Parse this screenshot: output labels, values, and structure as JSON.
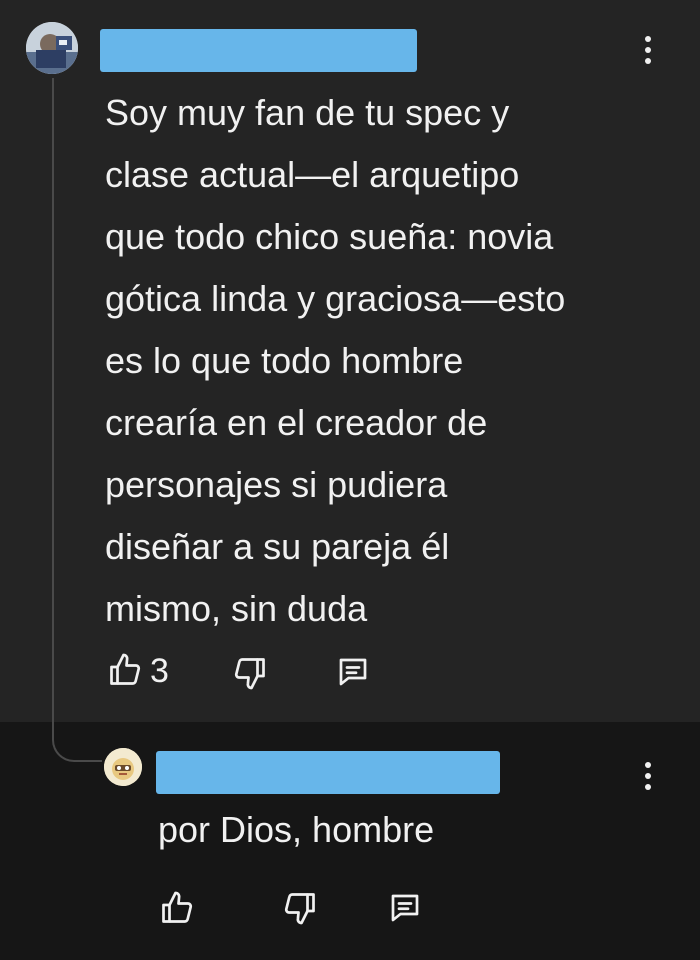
{
  "comment": {
    "text": "Soy muy fan de tu spec y\nclase actual—el arquetipo\nque todo chico sueña: novia\ngótica linda y graciosa—esto\nes lo que todo hombre\ncrearía en el creador de\npersonajes si pudiera\ndiseñar a su pareja él\nmismo, sin duda",
    "like_count": "3",
    "icons": {
      "like": "thumbs-up-icon",
      "dislike": "thumbs-down-icon",
      "reply": "reply-icon",
      "more": "more-vert-icon"
    }
  },
  "reply": {
    "text": "por Dios, hombre",
    "icons": {
      "like": "thumbs-up-icon",
      "dislike": "thumbs-down-icon",
      "reply": "reply-icon",
      "more": "more-vert-icon"
    }
  },
  "colors": {
    "comment_bg": "#242424",
    "reply_bg": "#161616",
    "text": "#f1f1f1",
    "redaction": "#67b6ea",
    "thread_line": "#4a4a4a"
  }
}
